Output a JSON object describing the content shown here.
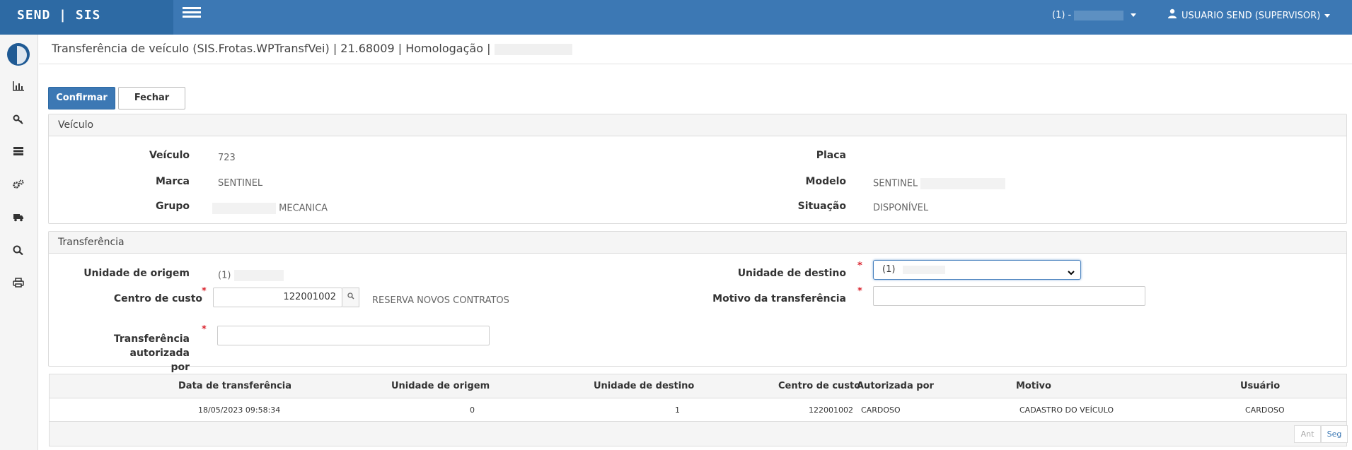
{
  "app": {
    "brand": "SEND | SIS"
  },
  "topbar": {
    "unit_label": "(1) -",
    "user_label": "USUARIO SEND (SUPERVISOR)"
  },
  "sidebar": {
    "icons": [
      "bar-chart-icon",
      "key-icon",
      "server-icon",
      "cogs-icon",
      "truck-icon",
      "search-icon",
      "print-icon"
    ]
  },
  "page": {
    "title": "Transferência de veículo (SIS.Frotas.WPTransfVei) | 21.68009 | Homologação |"
  },
  "toolbar": {
    "confirm_label": "Confirmar",
    "close_label": "Fechar"
  },
  "vehicle_panel": {
    "heading": "Veículo",
    "veiculo_label": "Veículo",
    "veiculo_value": "723",
    "placa_label": "Placa",
    "placa_value": "",
    "marca_label": "Marca",
    "marca_value": "SENTINEL",
    "modelo_label": "Modelo",
    "modelo_value": "SENTINEL",
    "grupo_label": "Grupo",
    "grupo_value": "MECANICA",
    "situacao_label": "Situação",
    "situacao_value": "DISPONÍVEL"
  },
  "transfer_panel": {
    "heading": "Transferência",
    "origem_label": "Unidade de origem",
    "origem_value": "(1)",
    "destino_label": "Unidade de destino",
    "destino_value": "(1)",
    "centro_label": "Centro de custo",
    "centro_value": "122001002",
    "centro_desc": "RESERVA NOVOS CONTRATOS",
    "motivo_label": "Motivo da transferência",
    "motivo_value": "",
    "autorizada_label_1": "Transferência autorizada",
    "autorizada_label_2": "por",
    "autorizada_value": "",
    "required_mark": "*"
  },
  "table": {
    "headers": [
      "Data de transferência",
      "Unidade de origem",
      "Unidade de destino",
      "Centro de custo",
      "Autorizada por",
      "Motivo",
      "Usuário"
    ],
    "rows": [
      [
        "18/05/2023 09:58:34",
        "0",
        "1",
        "122001002",
        "CARDOSO",
        "CADASTRO DO VEÍCULO",
        "CARDOSO"
      ]
    ],
    "prev_label": "Ant",
    "next_label": "Seg"
  }
}
